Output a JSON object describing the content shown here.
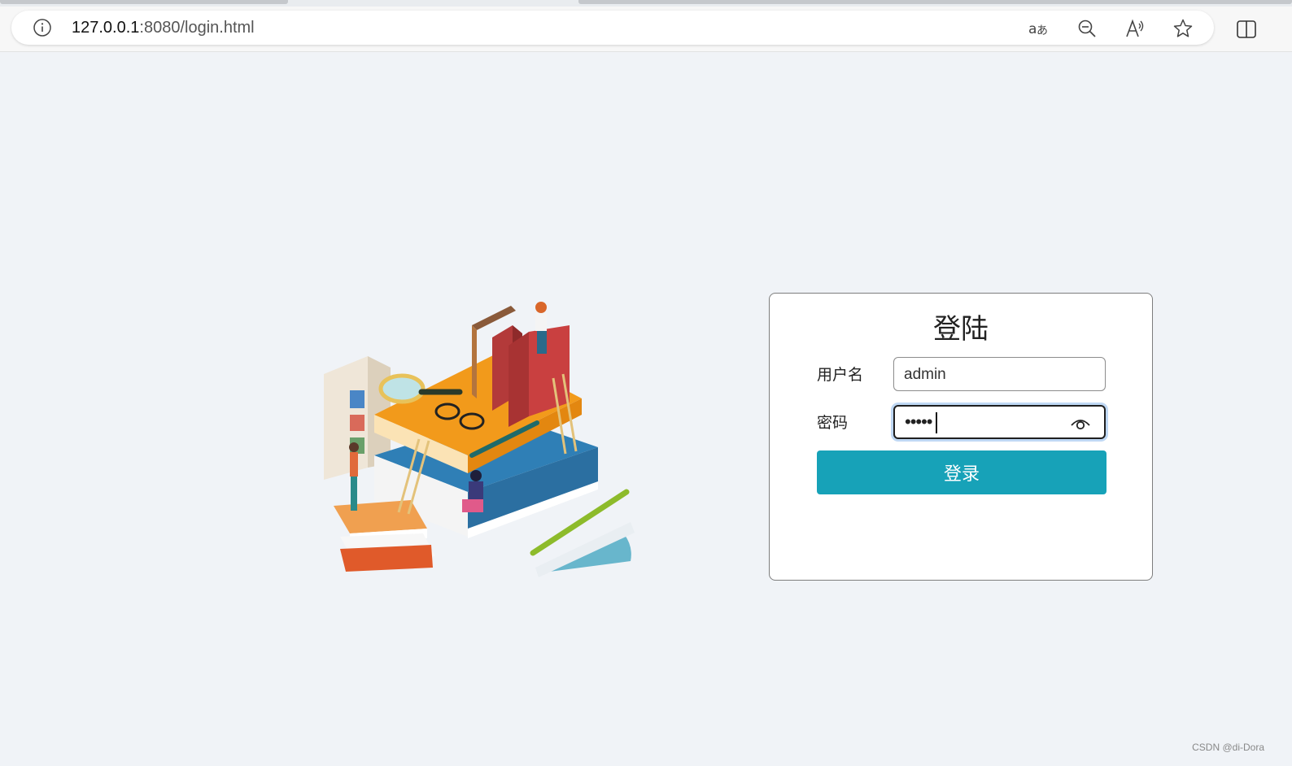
{
  "browser": {
    "url_host": "127.0.0.1",
    "url_path": ":8080/login.html"
  },
  "login": {
    "title": "登陆",
    "username_label": "用户名",
    "username_value": "admin",
    "password_label": "密码",
    "password_masked": "•••••",
    "submit_label": "登录"
  },
  "watermark": "CSDN @di-Dora",
  "colors": {
    "page_bg": "#f0f3f7",
    "button": "#17a2b8",
    "focus_ring": "#bfd8f4"
  },
  "icons": [
    "info-icon",
    "translate-icon",
    "zoom-out-icon",
    "read-aloud-icon",
    "favorite-star-icon",
    "split-screen-icon",
    "show-password-eye-icon"
  ]
}
